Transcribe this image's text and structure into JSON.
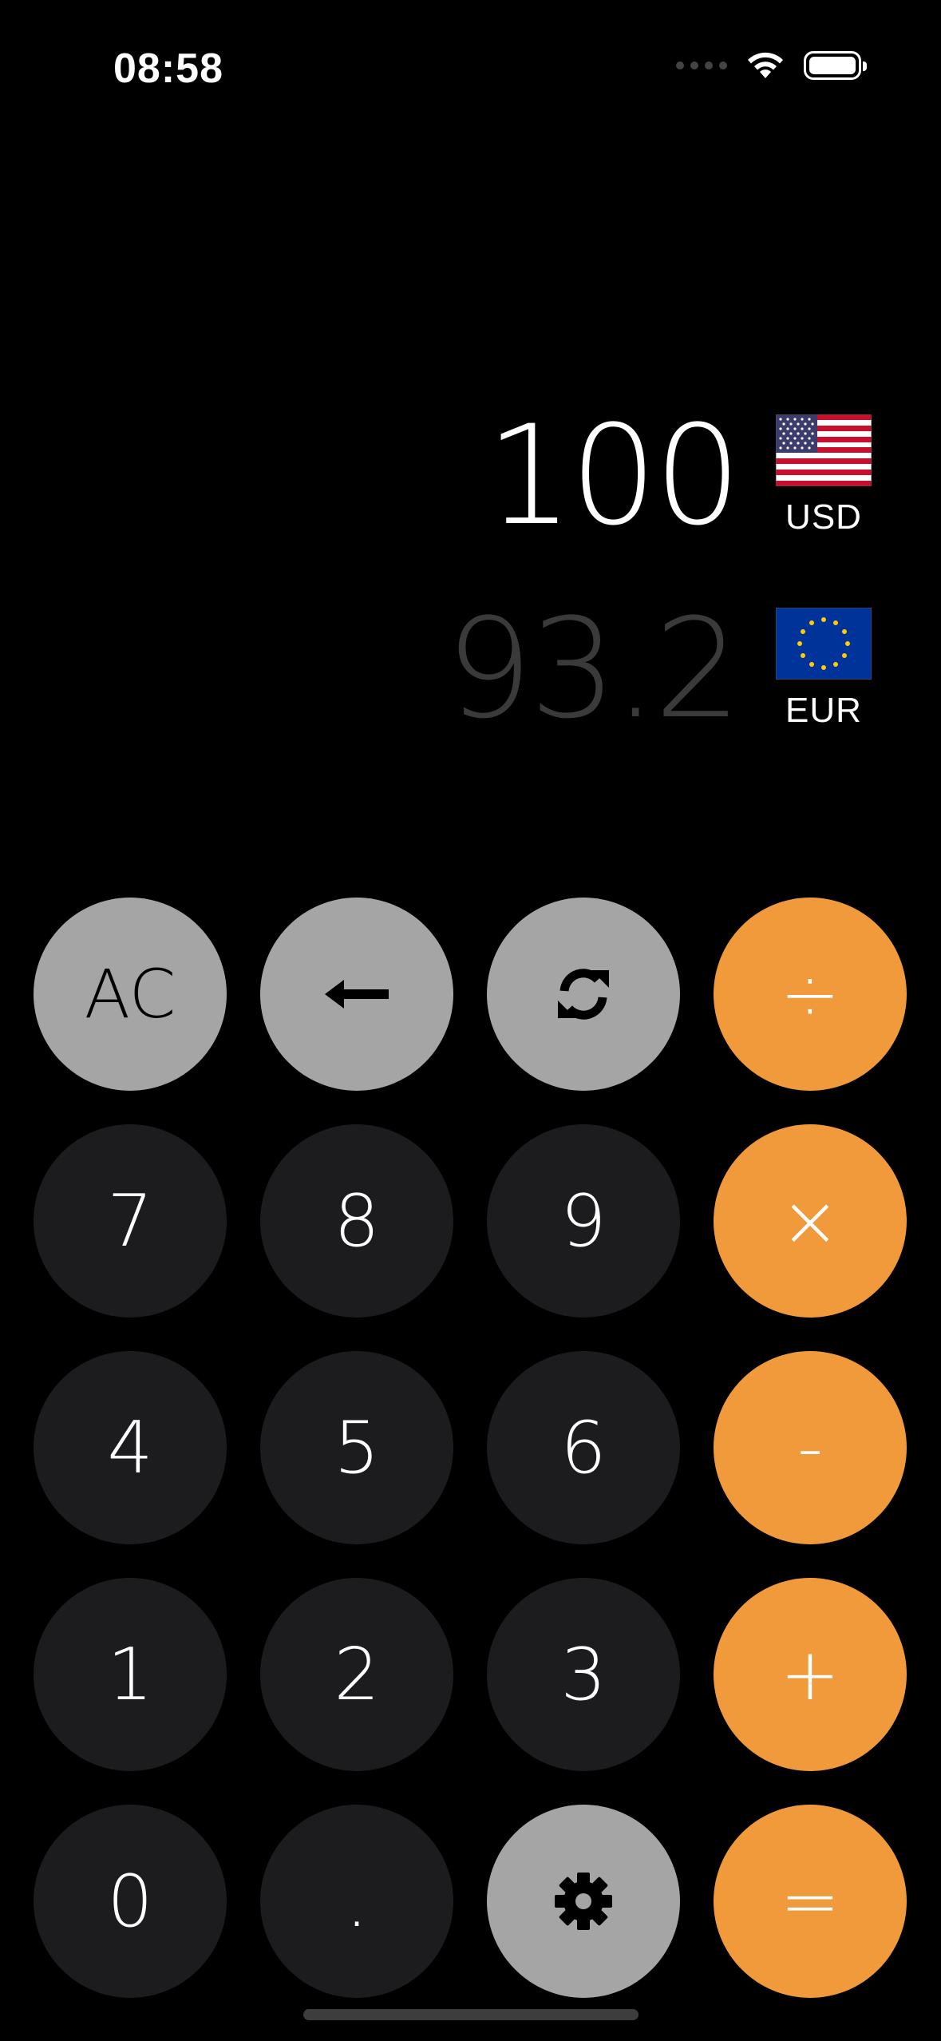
{
  "status_bar": {
    "time": "08:58",
    "icons": [
      "signal-dots-icon",
      "wifi-icon",
      "battery-icon"
    ]
  },
  "conversion": {
    "source": {
      "value": "100",
      "code": "USD",
      "flag": "us-flag-icon"
    },
    "target": {
      "value": "93.2",
      "code": "EUR",
      "flag": "eu-flag-icon"
    }
  },
  "keypad": {
    "rows": [
      [
        {
          "name": "all-clear-button",
          "label": "AC",
          "style": "gray"
        },
        {
          "name": "backspace-button",
          "icon": "arrow-left-icon",
          "style": "gray"
        },
        {
          "name": "swap-currencies-button",
          "icon": "refresh-icon",
          "style": "gray"
        },
        {
          "name": "divide-button",
          "label": "÷",
          "style": "orange"
        }
      ],
      [
        {
          "name": "digit-7-button",
          "label": "7",
          "style": "dark"
        },
        {
          "name": "digit-8-button",
          "label": "8",
          "style": "dark"
        },
        {
          "name": "digit-9-button",
          "label": "9",
          "style": "dark"
        },
        {
          "name": "multiply-button",
          "label": "×",
          "style": "orange"
        }
      ],
      [
        {
          "name": "digit-4-button",
          "label": "4",
          "style": "dark"
        },
        {
          "name": "digit-5-button",
          "label": "5",
          "style": "dark"
        },
        {
          "name": "digit-6-button",
          "label": "6",
          "style": "dark"
        },
        {
          "name": "subtract-button",
          "label": "-",
          "style": "orange"
        }
      ],
      [
        {
          "name": "digit-1-button",
          "label": "1",
          "style": "dark"
        },
        {
          "name": "digit-2-button",
          "label": "2",
          "style": "dark"
        },
        {
          "name": "digit-3-button",
          "label": "3",
          "style": "dark"
        },
        {
          "name": "add-button",
          "label": "+",
          "style": "orange"
        }
      ],
      [
        {
          "name": "digit-0-button",
          "label": "0",
          "style": "dark"
        },
        {
          "name": "decimal-point-button",
          "label": ".",
          "style": "dark"
        },
        {
          "name": "settings-button",
          "icon": "gear-icon",
          "style": "gray"
        },
        {
          "name": "equals-button",
          "label": "=",
          "style": "orange"
        }
      ]
    ]
  },
  "colors": {
    "background": "#000000",
    "digit_key": "#1c1c1e",
    "function_key": "#a5a5a5",
    "operator_key": "#f09a3b",
    "secondary_value": "#3a3a3a"
  }
}
